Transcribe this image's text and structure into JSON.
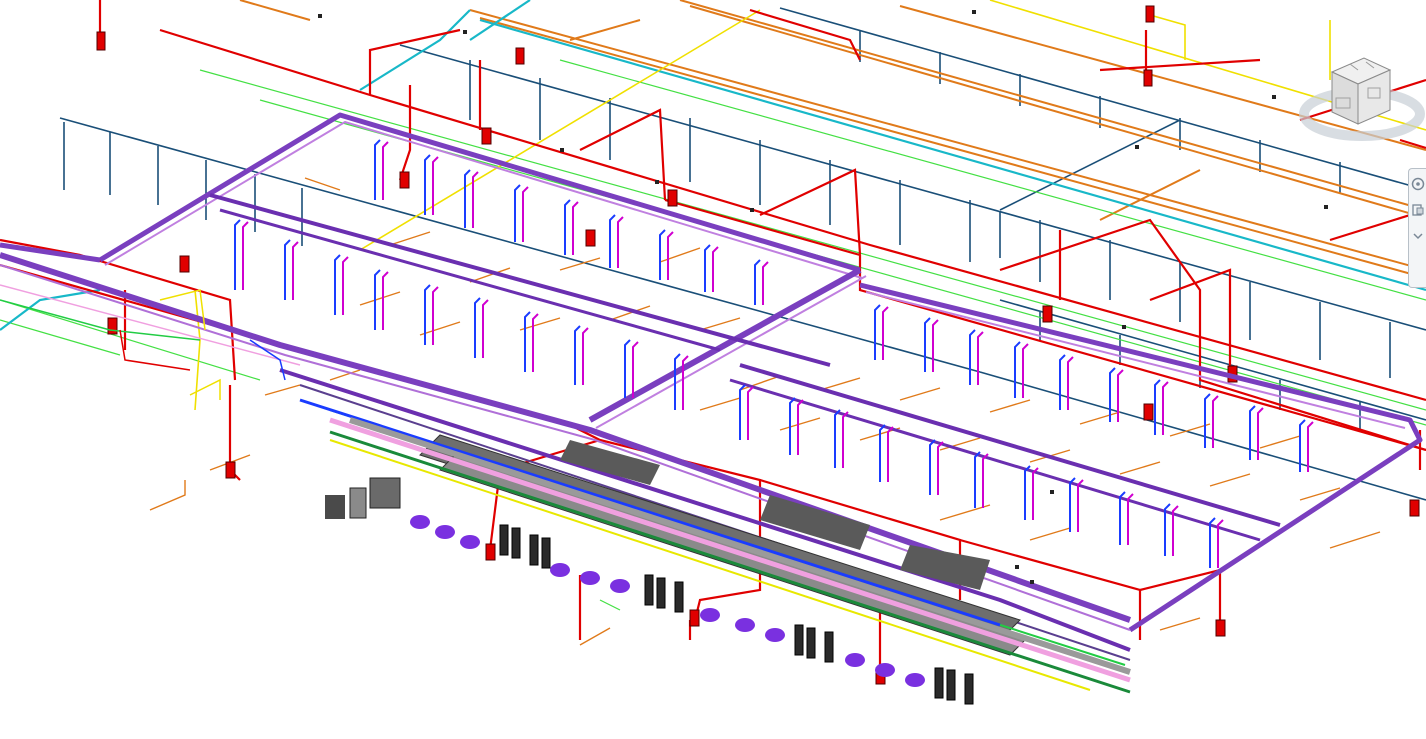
{
  "app": {
    "view_type": "3D isometric MEP model view"
  },
  "colors": {
    "background": "#ffffff",
    "fire_protection": "#e00000",
    "chilled_water": "#8a2be2",
    "hot_water": "#d000d0",
    "supply": "#1a3cff",
    "domestic_water": "#1a4f78",
    "drainage": "#e07a1a",
    "vent": "#22dd22",
    "gas": "#f0e000",
    "cyan_pipe": "#18b8c8",
    "equipment": "#7f7f7f"
  },
  "viewcube": {
    "icon": "viewcube-icon",
    "face_label": ""
  },
  "navbar": {
    "icons": [
      "steering-wheel-icon",
      "zoom-icon",
      "orbit-icon"
    ]
  }
}
